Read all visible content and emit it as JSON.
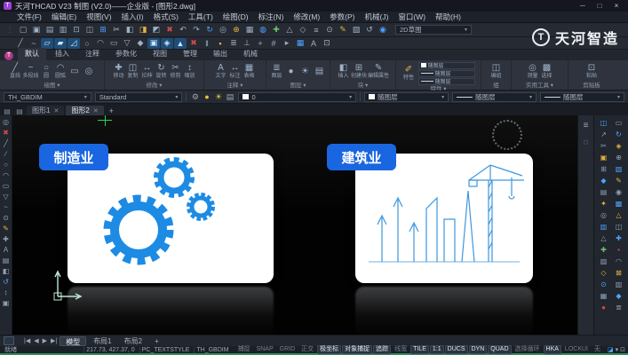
{
  "window": {
    "title": "天河THCAD V23 制图 (V2.0)——企业版 - [图形2.dwg]",
    "app_initial": "T",
    "controls": {
      "minimize": "─",
      "maximize": "□",
      "close": "×"
    }
  },
  "menu_bar": {
    "items": [
      "文件(F)",
      "编辑(E)",
      "视图(V)",
      "插入(I)",
      "格式(S)",
      "工具(T)",
      "绘图(D)",
      "标注(N)",
      "修改(M)",
      "参数(P)",
      "机械(J)",
      "窗口(W)",
      "帮助(H)"
    ]
  },
  "brand": {
    "text": "天河智造",
    "circle": "T"
  },
  "workspace_dropdown": {
    "value": "2D草图",
    "caret": "▾"
  },
  "toolbar1": {
    "icons": [
      {
        "g": "▢",
        "c": "#9db1c6"
      },
      {
        "g": "▣",
        "c": "#9db1c6"
      },
      {
        "g": "▤",
        "c": "#9db1c6"
      },
      {
        "g": "▥",
        "c": "#9db1c6"
      },
      {
        "g": "⊡",
        "c": "#9db1c6"
      },
      {
        "g": "◫",
        "c": "#9db1c6"
      },
      {
        "g": "⊞",
        "c": "#4da3ff"
      },
      {
        "g": "✂",
        "c": "#b8c4d2"
      },
      {
        "g": "◧",
        "c": "#9db1c6"
      },
      {
        "g": "◨",
        "c": "#e3b341"
      },
      {
        "g": "◩",
        "c": "#9db1c6"
      },
      {
        "g": "✖",
        "c": "#cf4a4a"
      },
      {
        "g": "↶",
        "c": "#9db1c6"
      },
      {
        "g": "↷",
        "c": "#9db1c6"
      },
      {
        "g": "↻",
        "c": "#4da3ff"
      },
      {
        "g": "◎",
        "c": "#9db1c6"
      },
      {
        "g": "⊕",
        "c": "#e3b341"
      },
      {
        "g": "▦",
        "c": "#9db1c6"
      },
      {
        "g": "◍",
        "c": "#4da3ff"
      },
      {
        "g": "✚",
        "c": "#6fbf6f"
      },
      {
        "g": "△",
        "c": "#9db1c6"
      },
      {
        "g": "◇",
        "c": "#9db1c6"
      },
      {
        "g": "≡",
        "c": "#9db1c6"
      },
      {
        "g": "⊙",
        "c": "#9db1c6"
      },
      {
        "g": "✎",
        "c": "#e3b341"
      },
      {
        "g": "▧",
        "c": "#9db1c6"
      },
      {
        "g": "↺",
        "c": "#9db1c6"
      },
      {
        "g": "◉",
        "c": "#4da3ff"
      }
    ]
  },
  "toolbar2": {
    "icons": [
      {
        "g": "╱",
        "c": "#9db1c6"
      },
      {
        "g": "~",
        "c": "#9db1c6"
      },
      {
        "g": "▱",
        "c": "#cfe3ff",
        "bg": "#1e4e78"
      },
      {
        "g": "▰",
        "c": "#cfe3ff",
        "bg": "#1e4e78"
      },
      {
        "g": "◿",
        "c": "#cfe3ff",
        "bg": "#1e4e78"
      },
      {
        "g": "○",
        "c": "#9db1c6"
      },
      {
        "g": "◠",
        "c": "#9db1c6"
      },
      {
        "g": "▭",
        "c": "#9db1c6"
      },
      {
        "g": "▽",
        "c": "#9db1c6"
      },
      {
        "g": "◆",
        "c": "#9db1c6"
      },
      {
        "g": "▣",
        "c": "#cfe3ff",
        "bg": "#1e4e78"
      },
      {
        "g": "◈",
        "c": "#cfe3ff",
        "bg": "#1e4e78"
      },
      {
        "g": "▲",
        "c": "#cfe3ff",
        "bg": "#1e4e78"
      },
      {
        "g": "✖",
        "c": "#cf4a4a"
      },
      {
        "g": "‖",
        "c": "#9db1c6"
      },
      {
        "g": "▪",
        "c": "#e3b341"
      },
      {
        "g": "≣",
        "c": "#9db1c6"
      },
      {
        "g": "⊥",
        "c": "#9db1c6"
      },
      {
        "g": "+",
        "c": "#9db1c6"
      },
      {
        "g": "#",
        "c": "#9db1c6"
      },
      {
        "g": "▸",
        "c": "#9db1c6"
      },
      {
        "g": "▦",
        "c": "#4da3ff"
      },
      {
        "g": "A",
        "c": "#9db1c6"
      },
      {
        "g": "⊡",
        "c": "#9db1c6"
      }
    ]
  },
  "ribbon": {
    "tabs": [
      {
        "label": "默认",
        "active": true
      },
      {
        "label": "插入"
      },
      {
        "label": "注释"
      },
      {
        "label": "参数化"
      },
      {
        "label": "视图"
      },
      {
        "label": "管理"
      },
      {
        "label": "输出"
      },
      {
        "label": "机械"
      }
    ],
    "panels": [
      {
        "label": "绘图 ▾",
        "items": [
          {
            "g": "╱",
            "t": "直线"
          },
          {
            "g": "~",
            "t": "多段线"
          },
          {
            "g": "○",
            "t": "圆"
          },
          {
            "g": "◠",
            "t": "圆弧"
          },
          {
            "g": "▭",
            "t": ""
          },
          {
            "g": "◎",
            "t": ""
          }
        ]
      },
      {
        "label": "修改 ▾",
        "items": [
          {
            "g": "✚",
            "t": "移动"
          },
          {
            "g": "◫",
            "t": "复制"
          },
          {
            "g": "↔",
            "t": "拉伸"
          },
          {
            "g": "↻",
            "t": "旋转"
          },
          {
            "g": "✂",
            "t": "修剪"
          },
          {
            "g": "↕",
            "t": "缩放"
          }
        ]
      },
      {
        "label": "注释 ▾",
        "items": [
          {
            "g": "A",
            "t": "文字"
          },
          {
            "g": "↔",
            "t": "标注"
          },
          {
            "g": "▦",
            "t": "表格"
          }
        ]
      },
      {
        "label": "图层 ▾",
        "items": [
          {
            "g": "≣",
            "t": "图层"
          },
          {
            "g": "●",
            "t": ""
          },
          {
            "g": "☀",
            "t": ""
          },
          {
            "g": "▤",
            "t": ""
          }
        ]
      },
      {
        "label": "块 ▾",
        "items": [
          {
            "g": "◧",
            "t": "插入"
          },
          {
            "g": "⊞",
            "t": "创建块"
          },
          {
            "g": "✎",
            "t": "编辑属性"
          }
        ]
      },
      {
        "label": "特性 ▾",
        "brush": "✐",
        "rows": [
          "随图层",
          "随图层",
          "随图层"
        ]
      },
      {
        "label": "组",
        "items": [
          {
            "g": "◫",
            "t": "编组"
          }
        ]
      },
      {
        "label": "实用工具 ▾",
        "items": [
          {
            "g": "◎",
            "t": "测量"
          },
          {
            "g": "▩",
            "t": "选择"
          }
        ]
      },
      {
        "label": "剪贴板",
        "items": [
          {
            "g": "⊡",
            "t": "粘贴"
          }
        ]
      }
    ]
  },
  "propbar": {
    "dimstyle": "TH_GBDIM",
    "textstyle": "Standard",
    "layer_icons": [
      {
        "g": "⚙",
        "c": "#9aa7b5"
      },
      {
        "g": "●",
        "c": "#e8c33c"
      },
      {
        "g": "☀",
        "c": "#e8c33c"
      },
      {
        "g": "▤",
        "c": "#9aa7b5"
      }
    ],
    "layer_value": "0",
    "color_value": "随图层",
    "linetype_value": "随图层",
    "lineweight_value": "随图层",
    "caret": "▾"
  },
  "file_tabs": {
    "tabs": [
      {
        "label": "图形1"
      },
      {
        "label": "图形2",
        "active": true
      }
    ],
    "close_glyph": "✕",
    "add_label": "+"
  },
  "canvas": {
    "cards": [
      {
        "label": "制造业"
      },
      {
        "label": "建筑业"
      }
    ],
    "accent_blue": "#1a66e0",
    "gear_blue": "#1d8be4",
    "lineart_blue": "#3e97dd"
  },
  "left_strip": {
    "icons": [
      {
        "g": "◎",
        "c": "#8ea2b6"
      },
      {
        "g": "✖",
        "c": "#cf4a4a"
      },
      {
        "g": "╱",
        "c": "#8ea2b6"
      },
      {
        "g": "∕",
        "c": "#8ea2b6"
      },
      {
        "g": "○",
        "c": "#8ea2b6"
      },
      {
        "g": "◠",
        "c": "#8ea2b6"
      },
      {
        "g": "▭",
        "c": "#8ea2b6"
      },
      {
        "g": "▽",
        "c": "#8ea2b6"
      },
      {
        "g": "~",
        "c": "#8ea2b6"
      },
      {
        "g": "⊙",
        "c": "#8ea2b6"
      },
      {
        "g": "✎",
        "c": "#e3b341"
      },
      {
        "g": "✚",
        "c": "#8ea2b6"
      },
      {
        "g": "A",
        "c": "#8ea2b6"
      },
      {
        "g": "▤",
        "c": "#8ea2b6"
      },
      {
        "g": "◧",
        "c": "#8ea2b6"
      },
      {
        "g": "↺",
        "c": "#4da3ff"
      },
      {
        "g": "↕",
        "c": "#8ea2b6"
      },
      {
        "g": "▣",
        "c": "#8ea2b6"
      }
    ]
  },
  "nav_strip": {
    "icons": [
      {
        "g": "≡",
        "c": "#9aa7b5"
      },
      {
        "g": "◌",
        "c": "#9aa7b5"
      }
    ]
  },
  "right_col_a": {
    "icons": [
      {
        "g": "◫",
        "c": "#4da3ff"
      },
      {
        "g": "↗",
        "c": "#8ea2b6"
      },
      {
        "g": "✂",
        "c": "#8ea2b6"
      },
      {
        "g": "▣",
        "c": "#e3b341"
      },
      {
        "g": "⊞",
        "c": "#8ea2b6"
      },
      {
        "g": "◆",
        "c": "#4da3ff"
      },
      {
        "g": "▤",
        "c": "#8ea2b6"
      },
      {
        "g": "✦",
        "c": "#e3b341"
      },
      {
        "g": "◎",
        "c": "#8ea2b6"
      },
      {
        "g": "▥",
        "c": "#4da3ff"
      },
      {
        "g": "△",
        "c": "#8ea2b6"
      },
      {
        "g": "✚",
        "c": "#6fbf6f"
      },
      {
        "g": "▨",
        "c": "#8ea2b6"
      },
      {
        "g": "◇",
        "c": "#e3b341"
      },
      {
        "g": "⊙",
        "c": "#4da3ff"
      },
      {
        "g": "▦",
        "c": "#8ea2b6"
      },
      {
        "g": "●",
        "c": "#cf4a4a"
      }
    ]
  },
  "right_col_b": {
    "icons": [
      {
        "g": "▭",
        "c": "#8ea2b6"
      },
      {
        "g": "↻",
        "c": "#4da3ff"
      },
      {
        "g": "◈",
        "c": "#e3b341"
      },
      {
        "g": "⊕",
        "c": "#8ea2b6"
      },
      {
        "g": "▧",
        "c": "#4da3ff"
      },
      {
        "g": "✎",
        "c": "#e3b341"
      },
      {
        "g": "◉",
        "c": "#8ea2b6"
      },
      {
        "g": "▩",
        "c": "#4da3ff"
      },
      {
        "g": "△",
        "c": "#e3b341"
      },
      {
        "g": "◫",
        "c": "#8ea2b6"
      },
      {
        "g": "✚",
        "c": "#4da3ff"
      },
      {
        "g": "▪",
        "c": "#cf4a4a"
      },
      {
        "g": "◠",
        "c": "#8ea2b6"
      },
      {
        "g": "⊠",
        "c": "#e3b341"
      },
      {
        "g": "▥",
        "c": "#8ea2b6"
      },
      {
        "g": "◆",
        "c": "#4da3ff"
      },
      {
        "g": "≣",
        "c": "#8ea2b6"
      }
    ]
  },
  "layout_bar": {
    "arrows": [
      "|◀",
      "◀",
      "▶",
      "▶|"
    ],
    "tabs": [
      {
        "label": "模型",
        "active": true
      },
      {
        "label": "布局1"
      },
      {
        "label": "布局2"
      }
    ],
    "add_label": "+"
  },
  "status_bar": {
    "ready": "就绪",
    "coords": "217.73, 427.37, 0",
    "textstyle": "PC_TEXTSTYLE",
    "dimstyle": "TH_GBDIM",
    "toggles": [
      {
        "label": "捕捉"
      },
      {
        "label": "SNAP"
      },
      {
        "label": "GRID"
      },
      {
        "label": "正交"
      },
      {
        "label": "极坐标",
        "on": true
      },
      {
        "label": "对象捕捉",
        "on": true
      },
      {
        "label": "追踪",
        "on": true
      },
      {
        "label": "线宽"
      },
      {
        "label": "TILE",
        "on": true
      },
      {
        "label": "1:1",
        "on": true
      },
      {
        "label": "DUCS",
        "on": true
      },
      {
        "label": "DYN",
        "on": true
      },
      {
        "label": "QUAD",
        "on": true
      },
      {
        "label": "选择循环"
      },
      {
        "label": "HKA",
        "on": true
      },
      {
        "label": "LOCKUI"
      },
      {
        "label": "无"
      }
    ],
    "right_icons": [
      {
        "g": "◪",
        "c": "#4da3ff"
      },
      {
        "g": "▾",
        "c": "#9aa7b5"
      },
      {
        "g": "⊡",
        "c": "#9aa7b5"
      }
    ]
  }
}
